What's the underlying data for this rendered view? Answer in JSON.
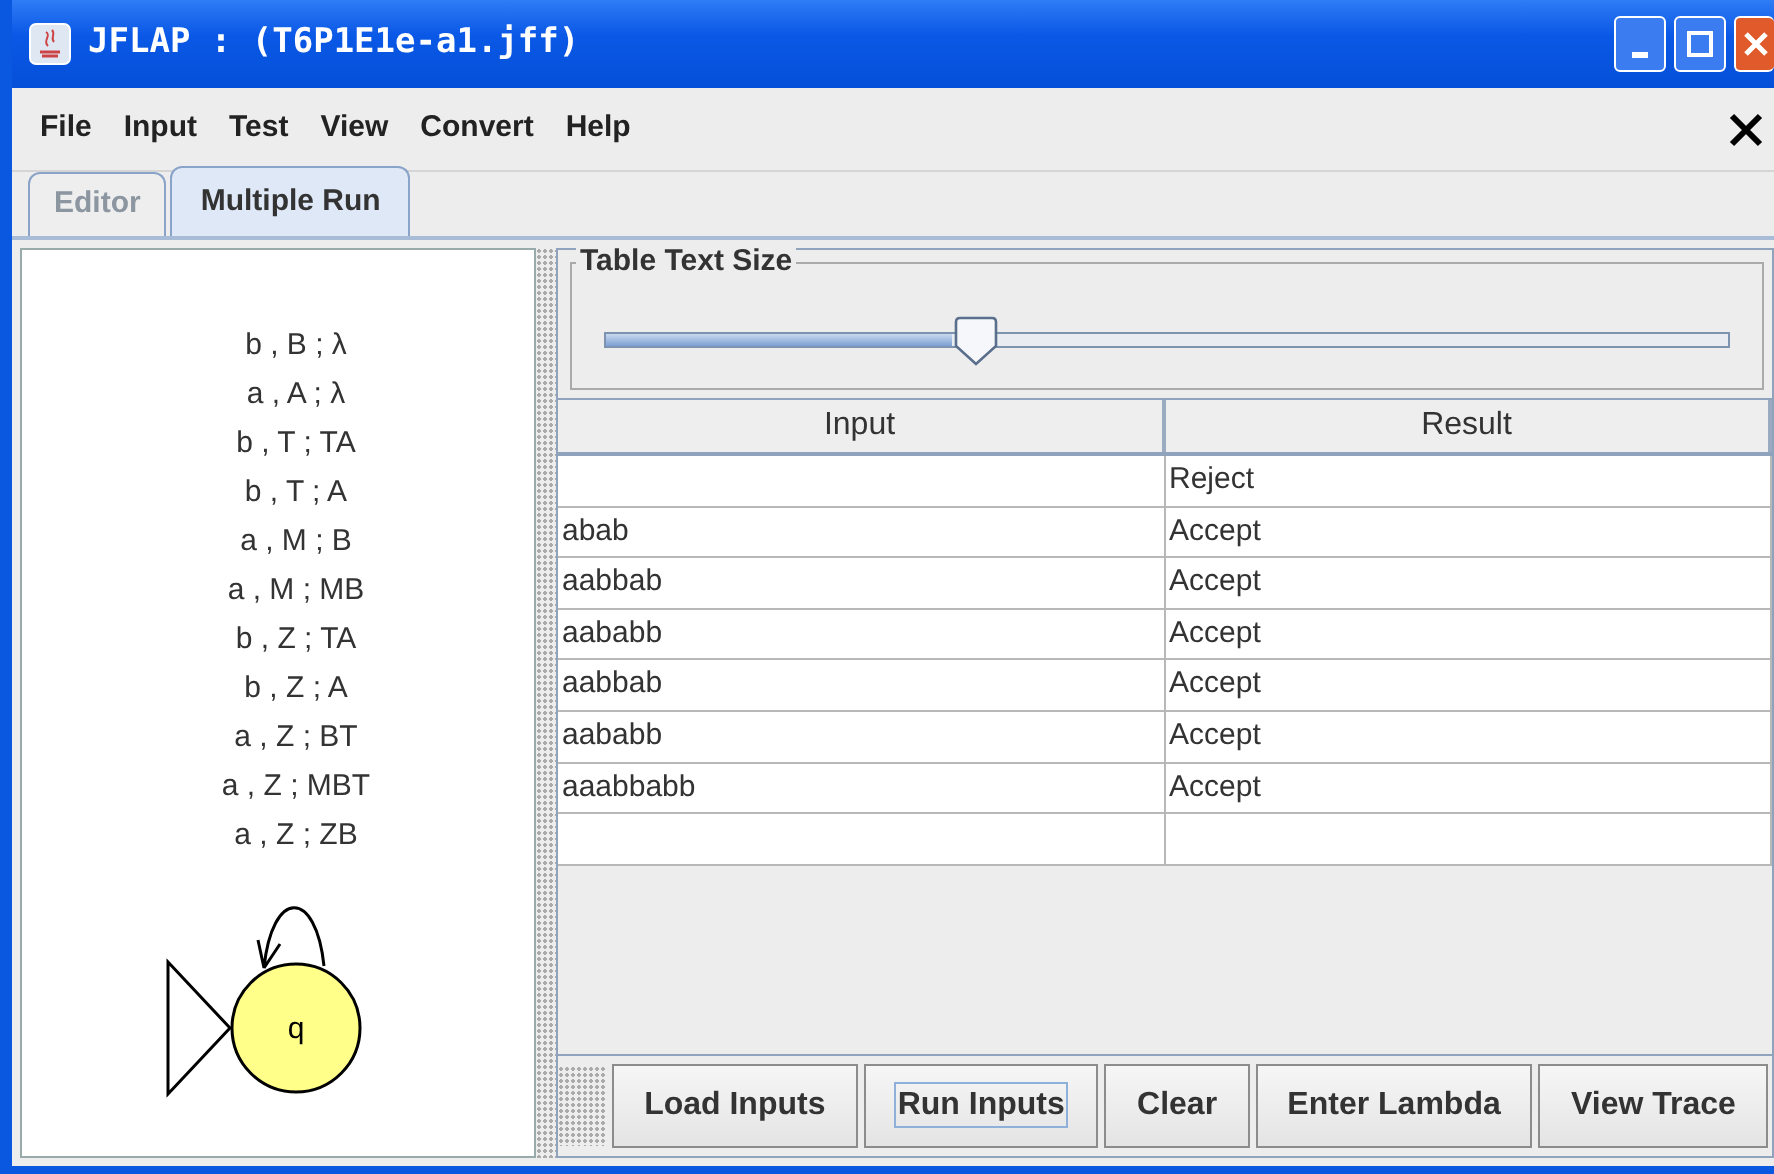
{
  "window": {
    "title": "JFLAP : (T6P1E1e-a1.jff)"
  },
  "menu": [
    "File",
    "Input",
    "Test",
    "View",
    "Convert",
    "Help"
  ],
  "tabs": [
    {
      "label": "Editor",
      "selected": false,
      "disabled": true
    },
    {
      "label": "Multiple Run",
      "selected": true,
      "disabled": false
    }
  ],
  "automaton": {
    "transition_labels": [
      "b , B ; λ",
      "a , A ; λ",
      "b , T ; TA",
      "b , T ; A",
      "a , M ; B",
      "a , M ; MB",
      "b , Z ; TA",
      "b , Z ; A",
      "a , Z ; BT",
      "a , Z ; MBT",
      "a , Z ; ZB"
    ],
    "states": [
      {
        "name": "q",
        "initial": true
      }
    ]
  },
  "text_size": {
    "title": "Table Text Size",
    "level": 0.33
  },
  "table": {
    "columns": [
      "Input",
      "Result"
    ],
    "rows": [
      {
        "result": "Reject"
      },
      {
        "input": "abab",
        "result": "Accept"
      },
      {
        "input": "aabbab",
        "result": "Accept"
      },
      {
        "input": "aababb",
        "result": "Accept"
      },
      {
        "input": "aabbab",
        "result": "Accept"
      },
      {
        "input": "aababb",
        "result": "Accept"
      },
      {
        "input": "aaabbabb",
        "result": "Accept"
      },
      {}
    ]
  },
  "buttons": [
    {
      "label": "Load Inputs",
      "focused": false
    },
    {
      "label": "Run Inputs",
      "focused": true
    },
    {
      "label": "Clear",
      "focused": false
    },
    {
      "label": "Enter Lambda",
      "focused": false
    },
    {
      "label": "View Trace",
      "focused": false
    }
  ]
}
